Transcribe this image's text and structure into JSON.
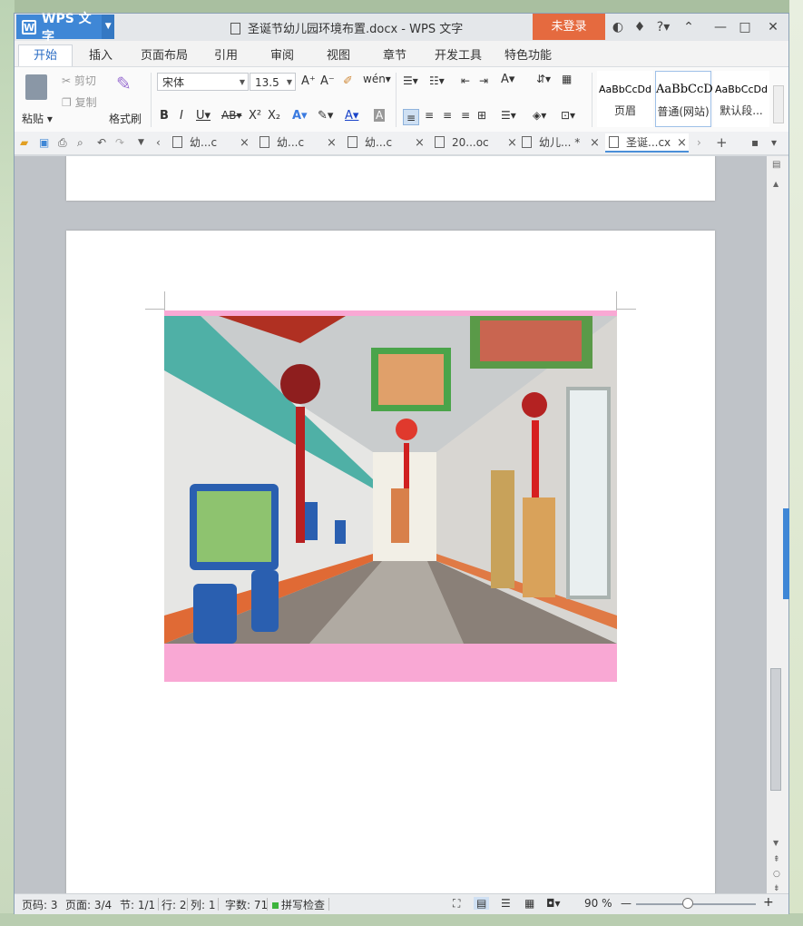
{
  "window": {
    "app_name": "WPS 文字",
    "doc_title": "圣诞节幼儿园环境布置.docx - WPS 文字",
    "login_label": "未登录",
    "accent_color": "#3f87d6",
    "login_color": "#e56a3f"
  },
  "ribbon_tabs": [
    "开始",
    "插入",
    "页面布局",
    "引用",
    "审阅",
    "视图",
    "章节",
    "开发工具",
    "特色功能"
  ],
  "clipboard": {
    "paste": "粘贴",
    "cut": "剪切",
    "copy": "复制",
    "format_painter": "格式刷"
  },
  "font": {
    "name": "宋体",
    "size": "13.5"
  },
  "styles": [
    {
      "sample": "AaBbCcDd",
      "name": "页眉"
    },
    {
      "sample": "AaBbCcD",
      "name": "普通(网站)"
    },
    {
      "sample": "AaBbCcDd",
      "name": "默认段..."
    }
  ],
  "doc_tabs": [
    {
      "label": "幼...c"
    },
    {
      "label": "幼...c"
    },
    {
      "label": "幼...c"
    },
    {
      "label": "20...oc"
    },
    {
      "label": "幼儿... *"
    },
    {
      "label": "圣诞...cx"
    }
  ],
  "status": {
    "page_code": "页码: 3",
    "pages": "页面: 3/4",
    "section": "节: 1/1",
    "row": "行: 2",
    "col": "列: 1",
    "word_count": "字数: 71",
    "spell_check": "拼写检查",
    "zoom": "90 %"
  },
  "photo": {
    "frame_color": "#f9a8d4",
    "description_icon": "photo-kindergarten-hallway"
  }
}
